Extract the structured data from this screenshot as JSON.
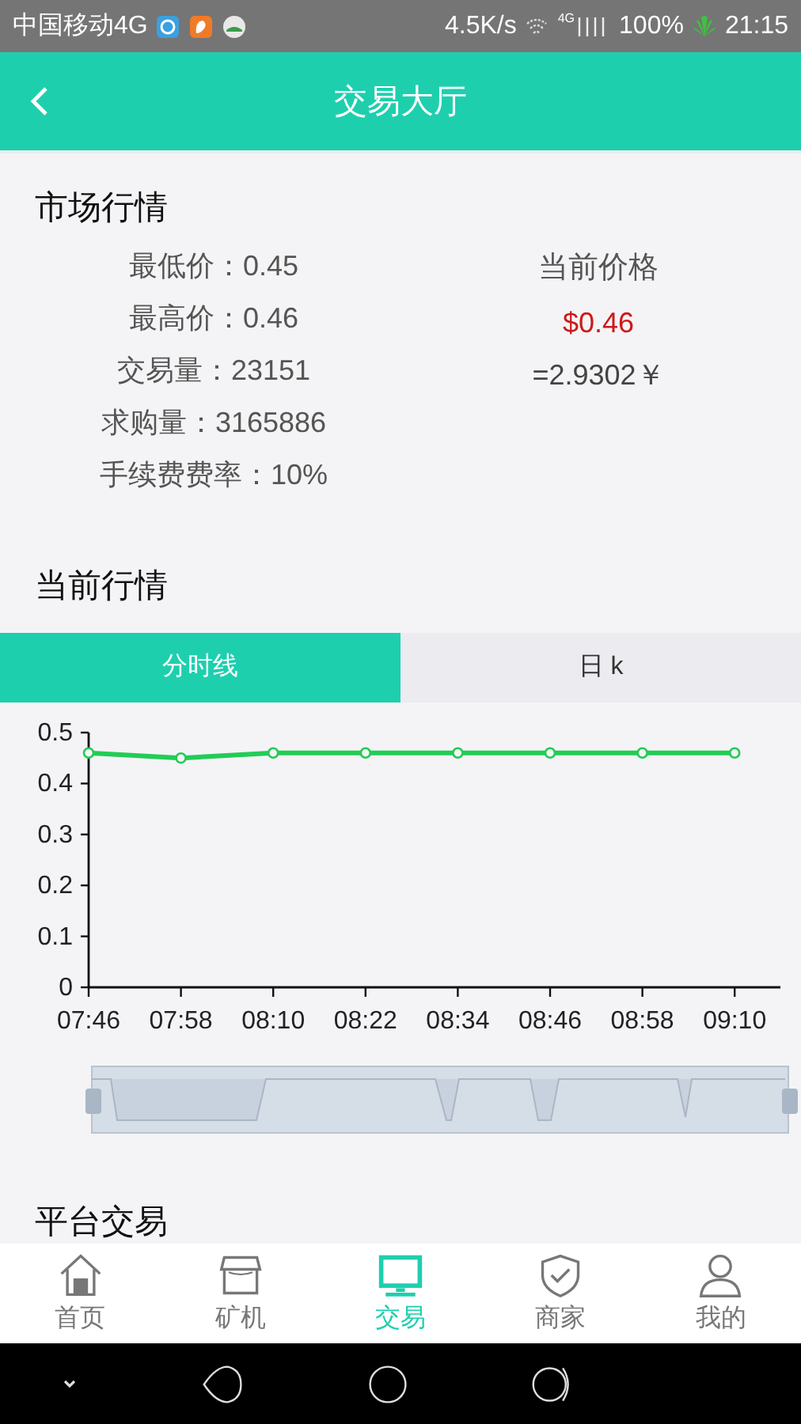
{
  "status_bar": {
    "carrier": "中国移动4G",
    "speed": "4.5K/s",
    "network": "4G",
    "battery": "100%",
    "time": "21:15"
  },
  "header": {
    "title": "交易大厅"
  },
  "market": {
    "title": "市场行情",
    "stats": [
      {
        "label": "最低价：",
        "value": "0.45"
      },
      {
        "label": "最高价：",
        "value": "0.46"
      },
      {
        "label": "交易量：",
        "value": "23151"
      },
      {
        "label": "求购量：",
        "value": "3165886"
      },
      {
        "label": "手续费费率：",
        "value": "10%"
      }
    ],
    "price_label": "当前价格",
    "price": "$0.46",
    "price_cny": "=2.9302￥"
  },
  "current": {
    "title": "当前行情",
    "tabs": [
      {
        "label": "分时线",
        "selected": true
      },
      {
        "label": "日 k",
        "selected": false
      }
    ],
    "chart_data": {
      "type": "line",
      "categories": [
        "07:46",
        "07:58",
        "08:10",
        "08:22",
        "08:34",
        "08:46",
        "08:58",
        "09:10"
      ],
      "series": [
        {
          "color": "#22cc55",
          "marker": "circle",
          "values": [
            0.46,
            0.45,
            0.46,
            0.46,
            0.46,
            0.46,
            0.46,
            0.46
          ]
        }
      ],
      "ylim": [
        0,
        0.5
      ],
      "yticks": [
        0,
        0.1,
        0.2,
        0.3,
        0.4,
        0.5
      ]
    }
  },
  "platform": {
    "title": "平台交易"
  },
  "nav": [
    {
      "kind": "home",
      "label": "首页",
      "selected": false
    },
    {
      "kind": "shop",
      "label": "矿机",
      "selected": false
    },
    {
      "kind": "monitor",
      "label": "交易",
      "selected": true
    },
    {
      "kind": "shield",
      "label": "商家",
      "selected": false
    },
    {
      "kind": "person",
      "label": "我的",
      "selected": false
    }
  ]
}
